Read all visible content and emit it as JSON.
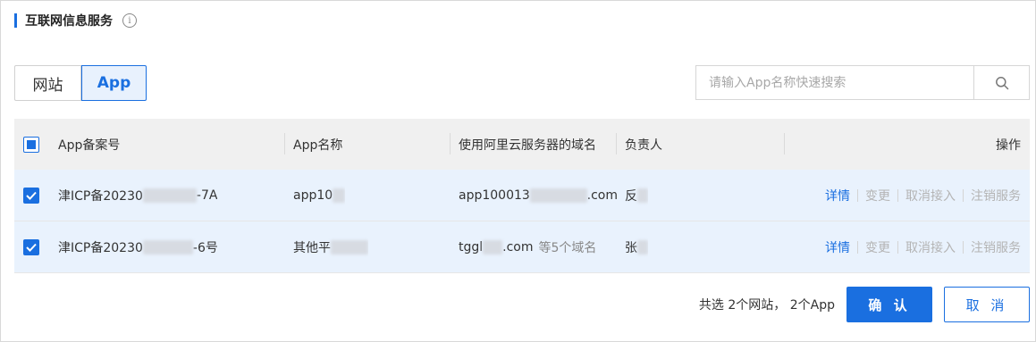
{
  "section": {
    "title": "互联网信息服务",
    "info_icon": "info-circle-icon"
  },
  "tabs": [
    {
      "label": "网站",
      "active": false
    },
    {
      "label": "App",
      "active": true
    }
  ],
  "search": {
    "placeholder": "请输入App名称快速搜索",
    "value": "",
    "icon": "search-icon"
  },
  "table": {
    "columns": [
      "App备案号",
      "App名称",
      "使用阿里云服务器的域名",
      "负责人",
      "操作"
    ],
    "rows": [
      {
        "checked": true,
        "record_prefix": "津ICP备20230",
        "record_suffix": "-7A",
        "app_name": "app10",
        "domain_prefix": "app100013",
        "domain_suffix": ".com",
        "domain_more": "",
        "owner": "反",
        "actions": [
          "详情",
          "变更",
          "取消接入",
          "注销服务"
        ]
      },
      {
        "checked": true,
        "record_prefix": "津ICP备20230",
        "record_suffix": "-6号",
        "app_name": "其他平",
        "domain_prefix": "tggl",
        "domain_suffix": ".com",
        "domain_more": "等5个域名",
        "owner": "张",
        "actions": [
          "详情",
          "变更",
          "取消接入",
          "注销服务"
        ]
      }
    ]
  },
  "footer": {
    "summary": "共选 2个网站， 2个App",
    "confirm_label": "确 认",
    "cancel_label": "取 消"
  },
  "colors": {
    "accent": "#1a6fe0",
    "row_selected": "#e9f2fd",
    "header_bg": "#f0f0f0"
  }
}
